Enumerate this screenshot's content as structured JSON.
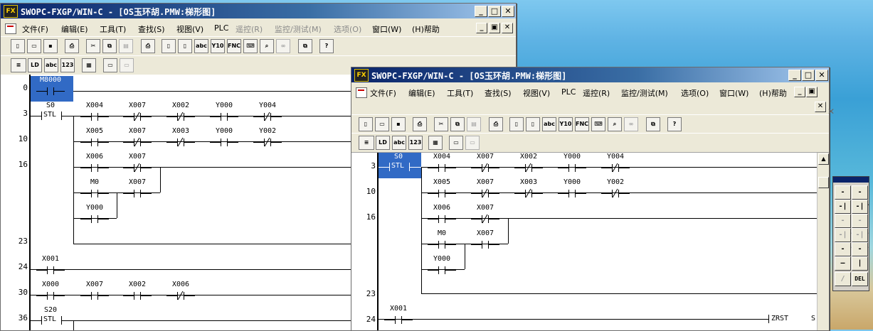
{
  "windows": {
    "back": {
      "title": "SWOPC-FXGP/WIN-C - [OS玉环胡.PMW:梯形图]",
      "menu": [
        "文件(F)",
        "编辑(E)",
        "工具(T)",
        "查找(S)",
        "视图(V)",
        "PLC",
        "遥控(R)",
        "监控/测试(M)",
        "选项(O)",
        "窗口(W)",
        "(H)帮助"
      ],
      "steps": [
        "0",
        "3",
        "10",
        "16",
        "23",
        "24",
        "30",
        "36"
      ],
      "contacts": {
        "m8000": "M8000",
        "s0": "S0",
        "x004": "X004",
        "x007a": "X007",
        "x002a": "X002",
        "y000a": "Y000",
        "y004": "Y004",
        "x005": "X005",
        "x007b": "X007",
        "x003": "X003",
        "y000b": "Y000",
        "y002": "Y002",
        "x006": "X006",
        "x007c": "X007",
        "m0": "M0",
        "x007d": "X007",
        "y000c": "Y000",
        "x001": "X001",
        "x000": "X000",
        "x007e": "X007",
        "x002b": "X002",
        "x006b": "X006",
        "s20": "S20"
      },
      "stl": "STL"
    },
    "front": {
      "title": "SWOPC-FXGP/WIN-C - [OS玉环胡.PMW:梯形图]",
      "menu": [
        "文件(F)",
        "编辑(E)",
        "工具(T)",
        "查找(S)",
        "视图(V)",
        "PLC",
        "遥控(R)",
        "监控/测试(M)",
        "选项(O)",
        "窗口(W)",
        "(H)帮助"
      ],
      "steps": [
        "3",
        "10",
        "16",
        "23",
        "24"
      ],
      "contacts": {
        "s0": "S0",
        "x004": "X004",
        "x007a": "X007",
        "x002a": "X002",
        "y000a": "Y000",
        "y004": "Y004",
        "x005": "X005",
        "x007b": "X007",
        "x003": "X003",
        "y000b": "Y000",
        "y002": "Y002",
        "x006": "X006",
        "x007c": "X007",
        "m0": "M0",
        "x007d": "X007",
        "y000c": "Y000",
        "x001": "X001"
      },
      "stl": "STL",
      "zrst": "ZRST",
      "trailing": "S("
    }
  },
  "toolbar_icons": [
    "new-icon",
    "open-icon",
    "save-icon",
    "print-icon",
    "cut-icon",
    "copy-icon",
    "paste-icon",
    "printer-setup-icon",
    "page-icons"
  ],
  "toolbar_text": {
    "y10": "Y10",
    "fnc": "FNC",
    "abc": "abc",
    "n123": "123",
    "help": "?"
  },
  "palette_labels": [
    "-||-",
    "-|/|-",
    "-|↑|-",
    "-|↓|-",
    "-|P|-",
    "-|F|-",
    "-|↑P|-",
    "-|↓F|-",
    "-()-",
    "-[]-",
    "—",
    "|",
    "/",
    "DEL"
  ],
  "colors": {
    "titlebar": "#0a246a",
    "selection": "#316ac5",
    "face": "#ece9d8"
  }
}
